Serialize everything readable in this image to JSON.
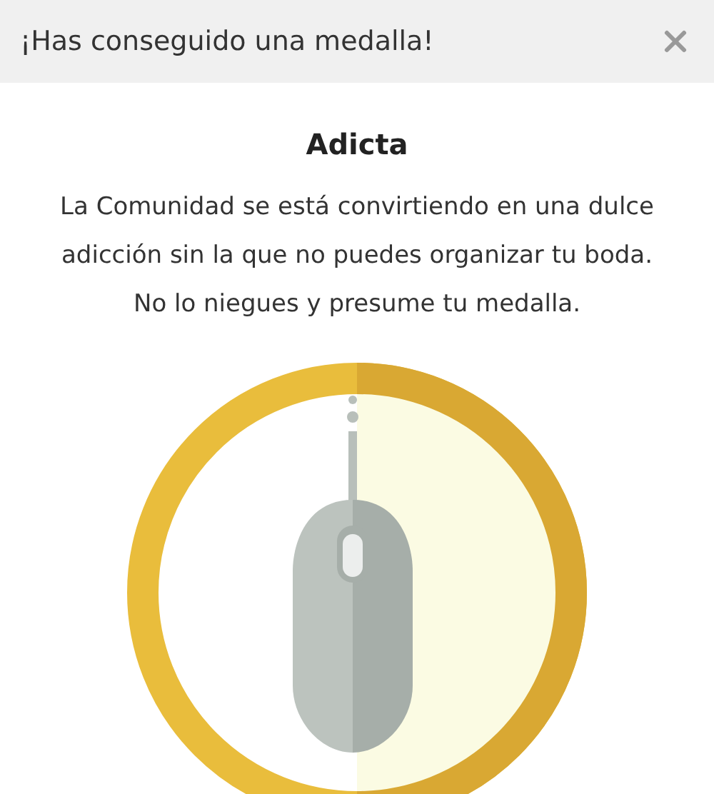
{
  "header": {
    "title": "¡Has conseguido una medalla!"
  },
  "badge": {
    "name": "Adicta",
    "description": "La Comunidad se está convirtiendo en una dulce adicción sin la que no puedes organizar tu boda. No lo niegues y presume tu medalla."
  }
}
